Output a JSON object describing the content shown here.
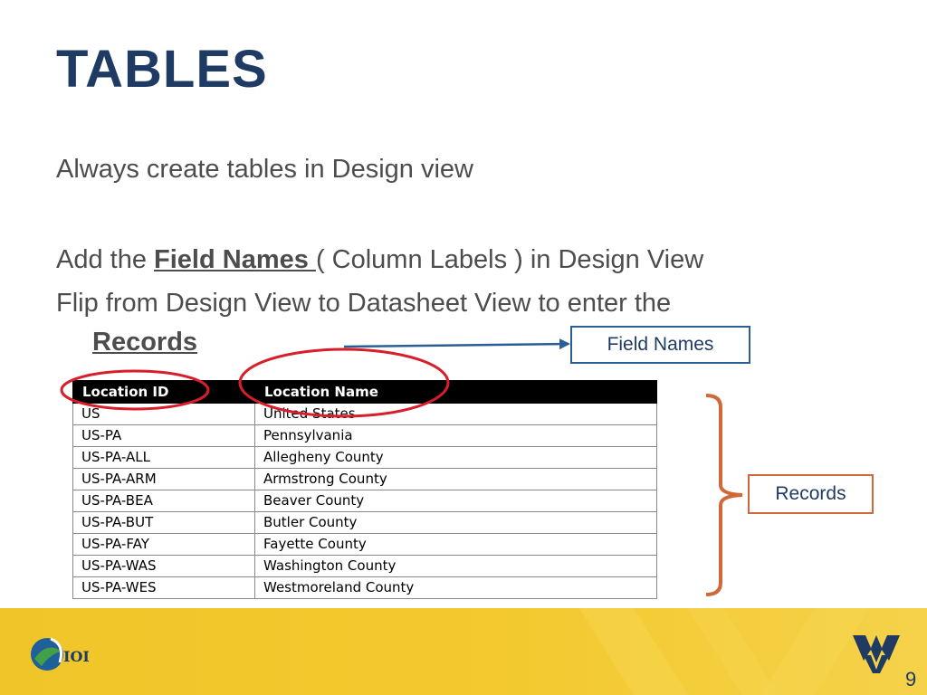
{
  "slide": {
    "title": "TABLES",
    "bullets": {
      "b1": "Always create tables in Design view",
      "b2_before": "Add the ",
      "b2_bold": "Field Names ",
      "b2_after": "( Column Labels ) in Design View",
      "b3_line1": "Flip from Design View to Datasheet View to enter the",
      "b3_bold": "Records"
    }
  },
  "table": {
    "headers": [
      "Location ID",
      "Location Name"
    ],
    "rows": [
      [
        "US",
        "United States"
      ],
      [
        "US-PA",
        "Pennsylvania"
      ],
      [
        "US-PA-ALL",
        "Allegheny County"
      ],
      [
        "US-PA-ARM",
        "Armstrong County"
      ],
      [
        "US-PA-BEA",
        "Beaver County"
      ],
      [
        "US-PA-BUT",
        "Butler County"
      ],
      [
        "US-PA-FAY",
        "Fayette County"
      ],
      [
        "US-PA-WAS",
        "Washington County"
      ],
      [
        "US-PA-WES",
        "Westmoreland County"
      ]
    ]
  },
  "callouts": {
    "field_names": "Field Names",
    "records": "Records"
  },
  "footer": {
    "logo_left_text": "IOI",
    "page_number": "9"
  },
  "colors": {
    "title": "#1f3b63",
    "text": "#4d4d4d",
    "circle": "#d81e2a",
    "arrow": "#2a5f96",
    "brace": "#d0683a",
    "footer": "#f0c52a"
  }
}
